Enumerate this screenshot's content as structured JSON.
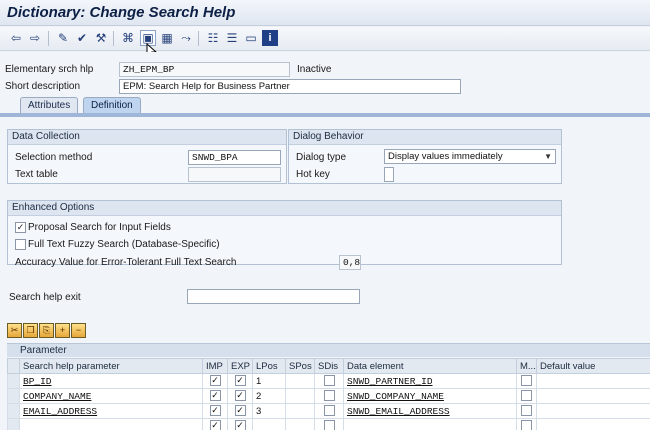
{
  "window": {
    "title": "Dictionary: Change Search Help"
  },
  "toolbar": {
    "icons": [
      "back-icon",
      "forward-icon",
      "toggle-display-change-icon",
      "check-icon",
      "activate-icon",
      "where-used-icon",
      "display-object-list-icon",
      "navigation-window-icon",
      "test-icon",
      "hierarchy-icon",
      "documentation-icon",
      "info-icon"
    ]
  },
  "header": {
    "elementary_label": "Elementary srch hlp",
    "elementary_value": "ZH_EPM_BP",
    "status": "Inactive",
    "short_desc_label": "Short description",
    "short_desc_value": "EPM: Search Help for Business Partner"
  },
  "tabs": [
    {
      "label": "Attributes",
      "active": false
    },
    {
      "label": "Definition",
      "active": true
    }
  ],
  "data_collection": {
    "title": "Data Collection",
    "selection_method_label": "Selection method",
    "selection_method_value": "SNWD_BPA",
    "text_table_label": "Text table",
    "text_table_value": ""
  },
  "dialog_behavior": {
    "title": "Dialog Behavior",
    "dialog_type_label": "Dialog type",
    "dialog_type_value": "Display values immediately",
    "hot_key_label": "Hot key",
    "hot_key_value": ""
  },
  "enhanced": {
    "title": "Enhanced Options",
    "proposal_label": "Proposal Search for Input Fields",
    "proposal_checked": true,
    "fuzzy_label": "Full Text Fuzzy Search (Database-Specific)",
    "fuzzy_checked": false,
    "accuracy_label": "Accuracy Value for Error-Tolerant Full Text Search",
    "accuracy_value": "0,8"
  },
  "exit": {
    "label": "Search help exit",
    "value": ""
  },
  "table": {
    "toolbar_icons": [
      "cut-icon",
      "copy-icon",
      "paste-icon",
      "insert-row-icon",
      "delete-row-icon"
    ],
    "caption": "Parameter",
    "headers": {
      "param": "Search help parameter",
      "imp": "IMP",
      "exp": "EXP",
      "lpos": "LPos",
      "spos": "SPos",
      "sdis": "SDis",
      "elem": "Data element",
      "m": "M...",
      "def": "Default value"
    },
    "rows": [
      {
        "param": "BP_ID",
        "imp": true,
        "exp": true,
        "lpos": "1",
        "spos": "",
        "sdis": false,
        "elem": "SNWD_PARTNER_ID",
        "m": false,
        "def": ""
      },
      {
        "param": "COMPANY_NAME",
        "imp": true,
        "exp": true,
        "lpos": "2",
        "spos": "",
        "sdis": false,
        "elem": "SNWD_COMPANY_NAME",
        "m": false,
        "def": ""
      },
      {
        "param": "EMAIL_ADDRESS",
        "imp": true,
        "exp": true,
        "lpos": "3",
        "spos": "",
        "sdis": false,
        "elem": "SNWD_EMAIL_ADDRESS",
        "m": false,
        "def": ""
      },
      {
        "param": "",
        "imp": true,
        "exp": true,
        "lpos": "",
        "spos": "",
        "sdis": false,
        "elem": "",
        "m": false,
        "def": ""
      }
    ]
  }
}
